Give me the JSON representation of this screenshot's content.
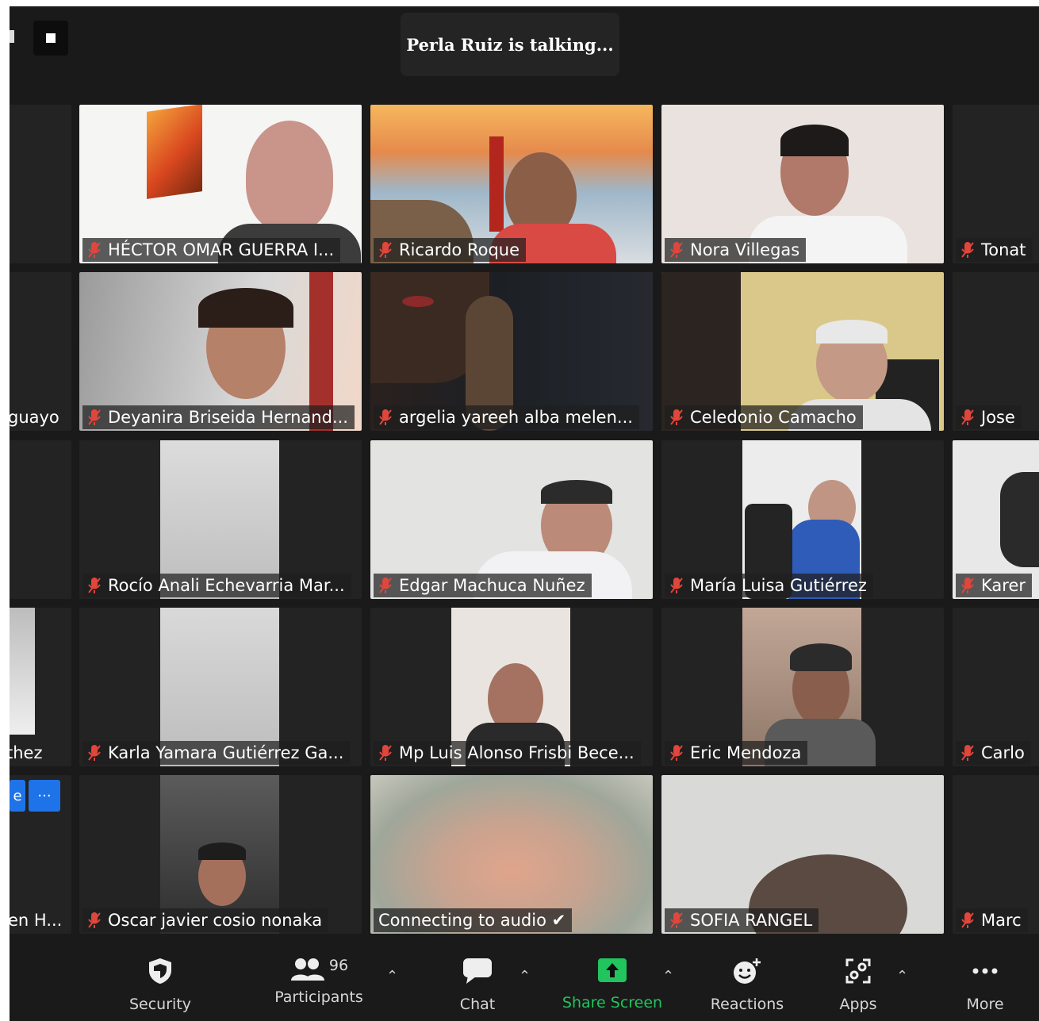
{
  "talking_indicator": "Perla Ruiz is talking...",
  "participants": [
    {
      "name": "HÉCTOR OMAR GUERRA I...",
      "muted": true
    },
    {
      "name": "Ricardo Roque",
      "muted": true
    },
    {
      "name": "Nora Villegas",
      "muted": true
    },
    {
      "name": "Tonat",
      "muted": true
    },
    {
      "name": "guayo",
      "muted": false
    },
    {
      "name": "Deyanira Briseida Hernand...",
      "muted": true
    },
    {
      "name": "argelia yareeh alba melen...",
      "muted": true
    },
    {
      "name": "Celedonio Camacho",
      "muted": true
    },
    {
      "name": "Jose",
      "muted": true
    },
    {
      "name": "Rocío Anali Echevarria Mar...",
      "muted": true
    },
    {
      "name": "Edgar Machuca Nuñez",
      "muted": true
    },
    {
      "name": "María Luisa Gutiérrez",
      "muted": true
    },
    {
      "name": "Karer",
      "muted": true
    },
    {
      "name": "thez",
      "muted": false
    },
    {
      "name": "Karla Yamara Gutiérrez Ga...",
      "muted": true
    },
    {
      "name": "Mp Luis Alonso Frisbi Bece...",
      "muted": true
    },
    {
      "name": "Eric Mendoza",
      "muted": true
    },
    {
      "name": "Carlo",
      "muted": true
    },
    {
      "name": "en H...",
      "muted": false
    },
    {
      "name": "Oscar javier cosio nonaka",
      "muted": true
    },
    {
      "name": "Connecting to audio ✔",
      "muted": false
    },
    {
      "name": "SOFIA RANGEL",
      "muted": true
    },
    {
      "name": "Marc",
      "muted": true
    }
  ],
  "side_buttons": {
    "left_label": "e",
    "more_label": "···"
  },
  "toolbar": {
    "security": "Security",
    "participants": "Participants",
    "participants_count": "96",
    "chat": "Chat",
    "share_screen": "Share Screen",
    "reactions": "Reactions",
    "apps": "Apps",
    "more": "More"
  },
  "colors": {
    "background": "#1a1a1a",
    "share_green": "#22c45e",
    "mute_red": "#e0463c",
    "blue_button": "#1f73e8"
  }
}
